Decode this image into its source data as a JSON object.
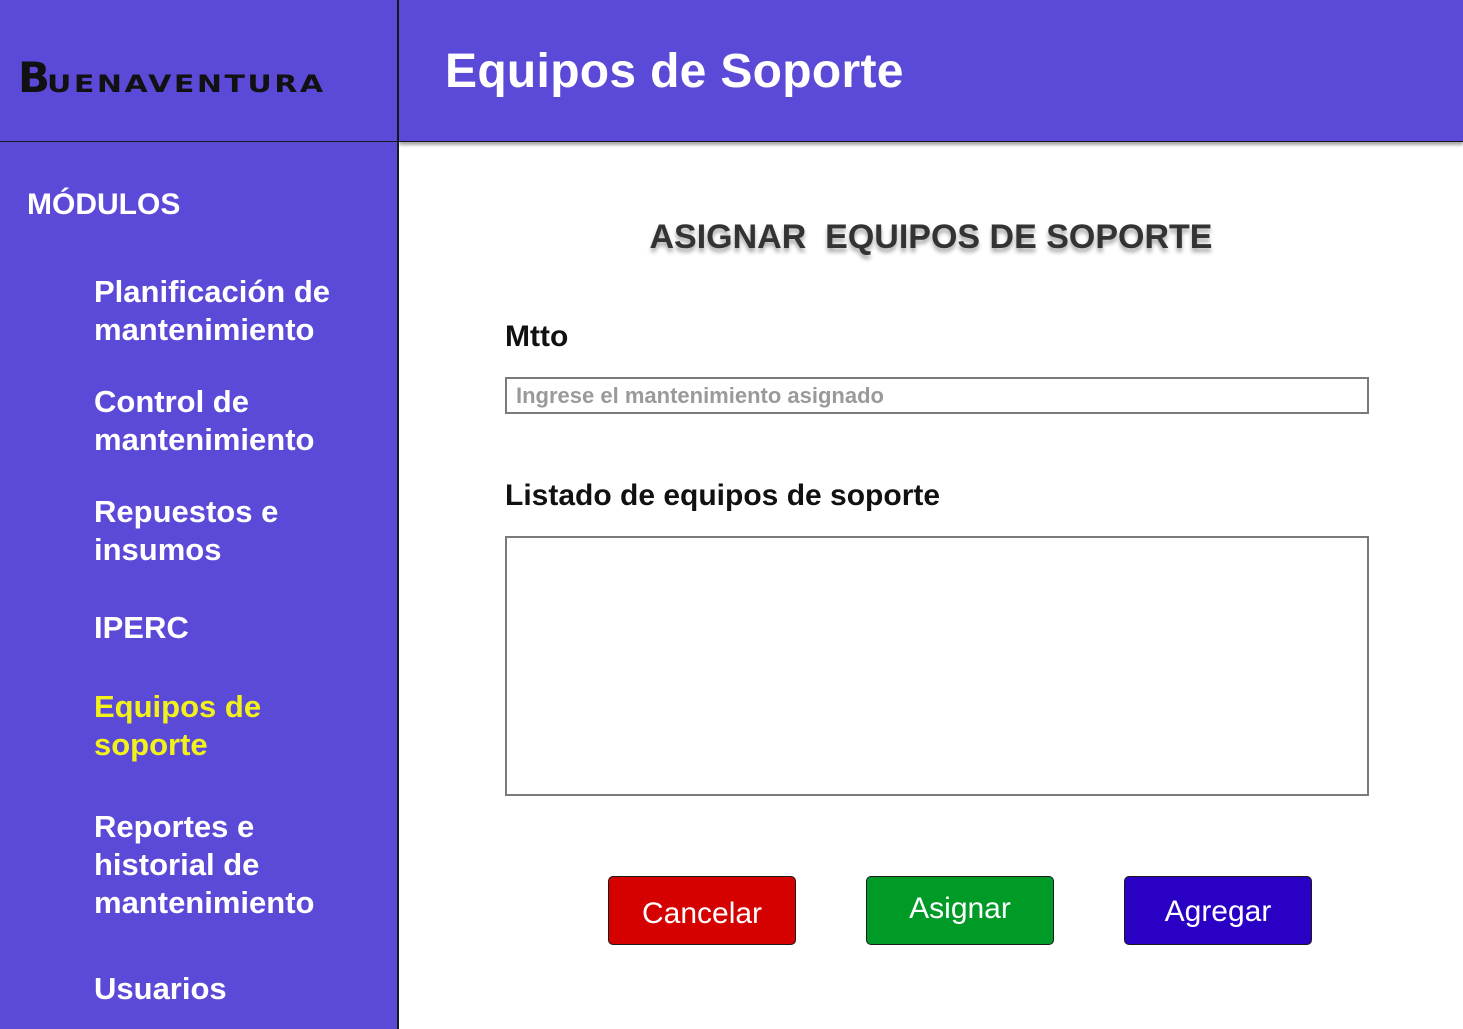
{
  "brand": {
    "logo_initial": "B",
    "logo_rest": "UENAVENTURA"
  },
  "header": {
    "title": "Equipos de Soporte"
  },
  "sidebar": {
    "heading": "MÓDULOS",
    "items": [
      {
        "label": "Planificación de mantenimiento",
        "active": false
      },
      {
        "label": "Control de mantenimiento",
        "active": false
      },
      {
        "label": "Repuestos e insumos",
        "active": false
      },
      {
        "label": "IPERC",
        "active": false
      },
      {
        "label": "Equipos de soporte",
        "active": true
      },
      {
        "label": "Reportes e historial de mantenimiento",
        "active": false
      },
      {
        "label": "Usuarios",
        "active": false
      }
    ]
  },
  "main": {
    "section_title": "ASIGNAR  EQUIPOS DE SOPORTE",
    "mtto_label": "Mtto",
    "mtto_value": "",
    "mtto_placeholder": "Ingrese el mantenimiento asignado",
    "list_label": "Listado de equipos de soporte",
    "list_items": []
  },
  "actions": {
    "cancel_label": "Cancelar",
    "assign_label": "Asignar",
    "add_label": "Agregar"
  },
  "colors": {
    "primary": "#5b4ad8",
    "active_nav": "#f2f21a",
    "cancel": "#d50000",
    "assign": "#009a26",
    "add": "#2a00c4"
  }
}
